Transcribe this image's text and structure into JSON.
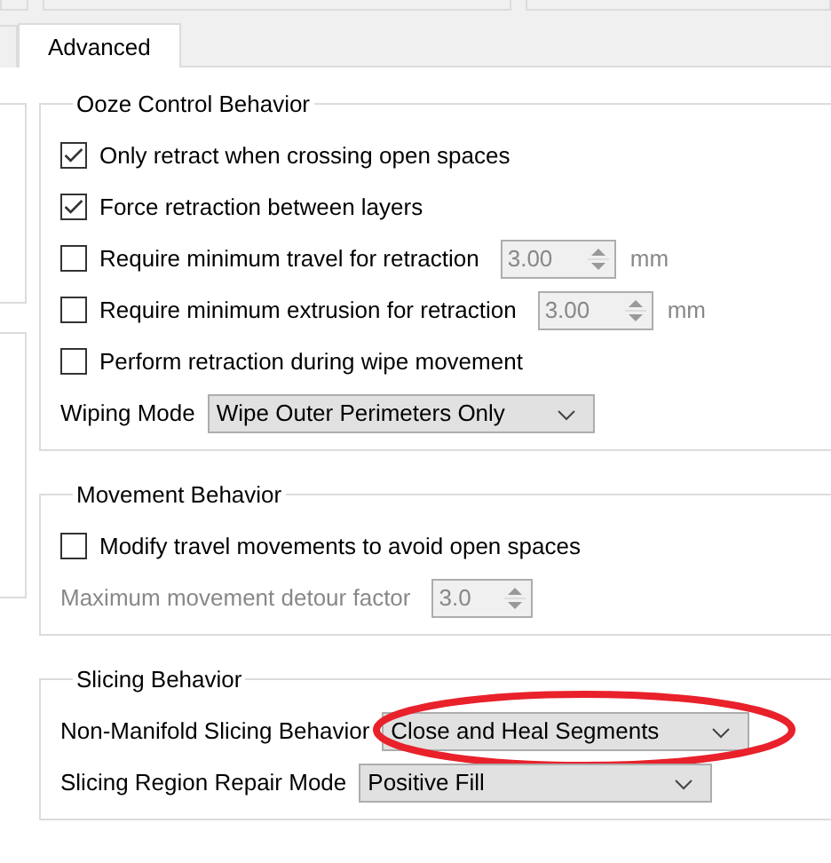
{
  "tabs": [
    {
      "label": "Advanced",
      "selected": true
    }
  ],
  "groups": [
    {
      "title": "Ooze Control Behavior",
      "rows": [
        {
          "kind": "checkbox",
          "label": "Only retract when crossing open spaces",
          "checked": true
        },
        {
          "kind": "checkbox",
          "label": "Force retraction between layers",
          "checked": true
        },
        {
          "kind": "checkbox",
          "label": "Require minimum travel for retraction",
          "checked": false,
          "spin": {
            "value": "3.00",
            "disabled": true
          },
          "unit": "mm"
        },
        {
          "kind": "checkbox",
          "label": "Require minimum extrusion for retraction",
          "checked": false,
          "spin": {
            "value": "3.00",
            "disabled": true
          },
          "unit": "mm"
        },
        {
          "kind": "checkbox",
          "label": "Perform retraction during wipe movement",
          "checked": false
        },
        {
          "kind": "combo",
          "label": "Wiping Mode",
          "value": "Wipe Outer Perimeters Only",
          "highlighted": false
        }
      ]
    },
    {
      "title": "Movement Behavior",
      "rows": [
        {
          "kind": "checkbox",
          "label": "Modify travel movements to avoid open spaces",
          "checked": false
        },
        {
          "kind": "spin",
          "label": "Maximum movement detour factor",
          "spin": {
            "value": "3.0",
            "disabled": true
          }
        }
      ]
    },
    {
      "title": "Slicing Behavior",
      "rows": [
        {
          "kind": "combo",
          "label": "Non-Manifold Slicing Behavior",
          "value": "Close and Heal Segments",
          "highlighted": true
        },
        {
          "kind": "combo",
          "label": "Slicing Region Repair Mode",
          "value": "Positive Fill",
          "highlighted": false
        }
      ]
    }
  ]
}
